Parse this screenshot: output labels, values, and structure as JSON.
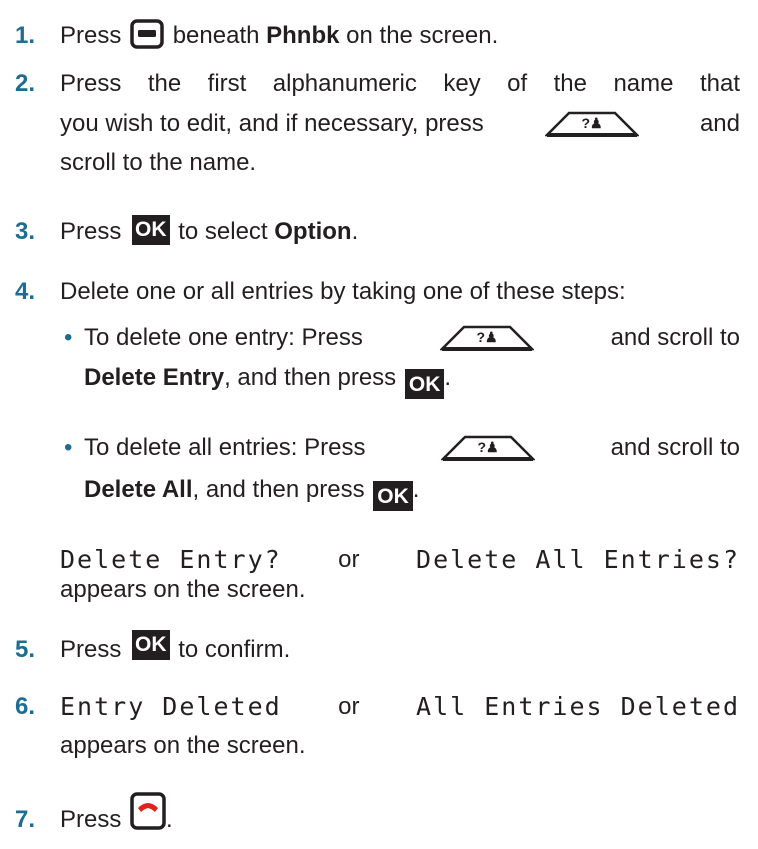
{
  "steps": [
    {
      "num": "1.",
      "pre": "Press",
      "post": "beneath",
      "bold": "Phnbk",
      "tail": "on the screen.",
      "icon": "softkey-button-icon"
    },
    {
      "num": "2.",
      "line1": "Press the first alphanumeric key of the name that",
      "line2a": "you wish to edit, and if necessary, press",
      "line2b": "and",
      "line3": "scroll to the name.",
      "icon": "phonebook-nav-key-icon"
    },
    {
      "num": "3.",
      "pre": "Press",
      "post": "to select",
      "bold": "Option",
      "tail": ".",
      "icon": "ok-key-icon",
      "icon_text": "OK"
    },
    {
      "num": "4.",
      "text": "Delete one or all entries by taking one of these steps:",
      "bullets": [
        {
          "a": "To delete one entry: Press",
          "b": "and scroll to",
          "bold": "Delete Entry",
          "c": ", and then press",
          "icon_text": "OK"
        },
        {
          "a": "To delete all entries: Press",
          "b": "and scroll to",
          "bold": "Delete All",
          "c": ", and then press",
          "icon_text": "OK"
        }
      ],
      "screen_a": "Delete Entry?",
      "or": "or",
      "screen_b": "Delete All Entries?",
      "after": "appears on the screen."
    },
    {
      "num": "5.",
      "pre": "Press",
      "post": "to confirm.",
      "icon_text": "OK"
    },
    {
      "num": "6.",
      "screen_a": "Entry Deleted",
      "or": "or",
      "screen_b": "All Entries Deleted",
      "after": "appears on the screen."
    },
    {
      "num": "7.",
      "pre": "Press",
      "tail": ".",
      "icon": "end-call-key-icon"
    }
  ],
  "colors": {
    "accent": "#1f6c92",
    "end_call": "#e0211c",
    "text": "#231f20"
  }
}
